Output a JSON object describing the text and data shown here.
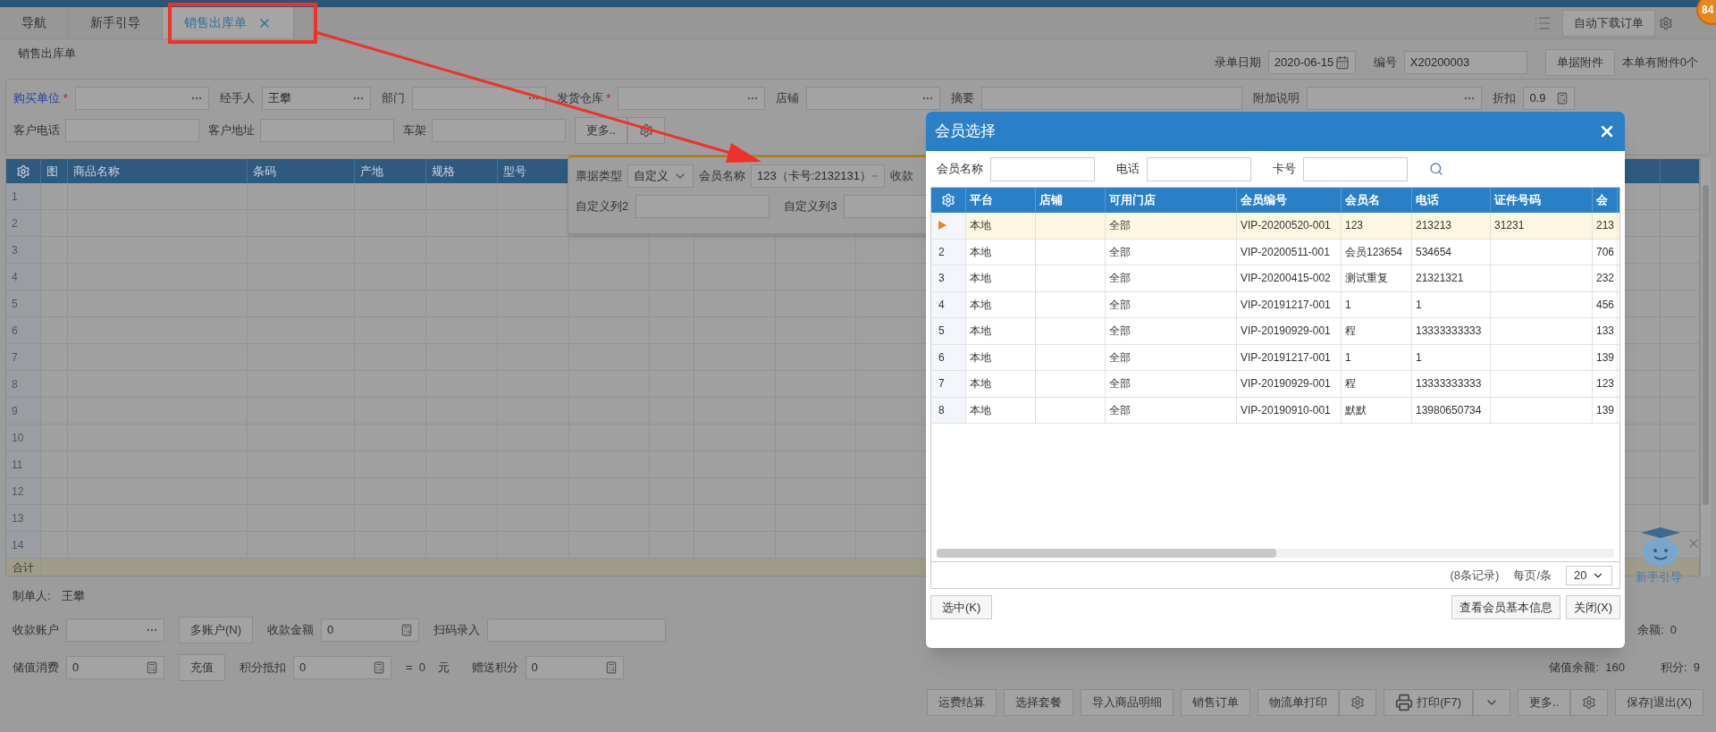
{
  "tabs": [
    {
      "label": "导航",
      "selected": false,
      "closable": false
    },
    {
      "label": "新手引导",
      "selected": false,
      "closable": false
    },
    {
      "label": "销售出库单",
      "selected": true,
      "closable": true
    }
  ],
  "top_right": {
    "button": "自动下载订单",
    "badge": "84"
  },
  "page_title": "销售出库单",
  "header_fields": [
    {
      "label": "录单日期",
      "value": "2020-06-15",
      "kind": "date"
    },
    {
      "label": "编号",
      "value": "X20200003"
    }
  ],
  "attachment": {
    "button": "单据附件",
    "note": "本单有附件0个"
  },
  "form_row_1": [
    {
      "label": "购买单位",
      "mark": "*",
      "link": true,
      "kind": "lookup"
    },
    {
      "label": "经手人",
      "value": "王攀",
      "kind": "lookup"
    },
    {
      "label": "部门",
      "kind": "lookup"
    },
    {
      "label": "发货仓库",
      "mark": "*",
      "kind": "lookup"
    },
    {
      "label": "店铺",
      "kind": "lookup"
    },
    {
      "label": "摘要"
    },
    {
      "label": "附加说明",
      "kind": "lookup"
    },
    {
      "label": "折扣",
      "value": "0.9",
      "kind": "calc"
    }
  ],
  "form_row_2": [
    {
      "label": "客户电话"
    },
    {
      "label": "客户地址"
    },
    {
      "label": "车架"
    }
  ],
  "more_button": "更多..",
  "more_panel": {
    "row_1": [
      {
        "label": "票据类型",
        "value": "自定义",
        "kind": "select"
      },
      {
        "label": "会员名称",
        "value": "123（卡号:2132131）",
        "kind": "lookup"
      },
      {
        "label": "收款",
        "kind": "cut"
      }
    ],
    "row_2": [
      {
        "label": "自定义列2"
      },
      {
        "label": "自定义列3"
      }
    ]
  },
  "grid": {
    "columns": [
      "图",
      "商品名称",
      "条码",
      "产地",
      "规格",
      "型号"
    ],
    "rows": [
      "1",
      "2",
      "3",
      "4",
      "5",
      "6",
      "7",
      "8",
      "9",
      "10",
      "11",
      "12",
      "13",
      "14"
    ],
    "total_label": "合计"
  },
  "footer": {
    "maker_label": "制单人:",
    "maker": "王攀",
    "row_1": [
      {
        "label": "收款账户",
        "kind": "lookup"
      },
      {
        "button": "多账户(N)",
        "kind": "button"
      },
      {
        "label": "收款金额",
        "value": "0",
        "kind": "calc"
      },
      {
        "label": "扫码录入",
        "kind": "wide"
      }
    ],
    "row_1_right": "余额:  0",
    "row_2": [
      {
        "label": "储值消费",
        "value": "0",
        "kind": "calc"
      },
      {
        "button": "充值",
        "kind": "button"
      },
      {
        "label": "积分抵扣",
        "value": "0",
        "kind": "calc"
      },
      {
        "text": "=  0    元",
        "kind": "text"
      },
      {
        "label": "赠送积分",
        "value": "0",
        "kind": "calc"
      }
    ],
    "row_2_right": [
      {
        "label": "储值余额:",
        "value": "160"
      },
      {
        "label": "积分:",
        "value": "9"
      }
    ]
  },
  "actions": [
    {
      "label": "运费结算",
      "kind": "plain"
    },
    {
      "label": "选择套餐",
      "kind": "plain"
    },
    {
      "label": "导入商品明细",
      "kind": "plain"
    },
    {
      "label": "销售订单",
      "kind": "plain"
    },
    {
      "label": "物流单打印",
      "kind": "gear"
    },
    {
      "label": "打印(F7)",
      "kind": "print"
    },
    {
      "label": "更多..",
      "kind": "gear"
    },
    {
      "label": "保存|退出(X)",
      "kind": "plain"
    }
  ],
  "guide": {
    "label": "新手引导"
  },
  "modal": {
    "title": "会员选择",
    "search": [
      {
        "label": "会员名称"
      },
      {
        "label": "电话"
      },
      {
        "label": "卡号"
      }
    ],
    "columns": [
      "平台",
      "店铺",
      "可用门店",
      "会员编号",
      "会员名",
      "电话",
      "证件号码",
      "会"
    ],
    "rows": [
      {
        "selected": true,
        "cells": [
          "本地",
          "",
          "全部",
          "VIP-20200520-001",
          "123",
          "213213",
          "31231",
          "213"
        ]
      },
      {
        "number": "2",
        "selected": false,
        "cells": [
          "本地",
          "",
          "全部",
          "VIP-20200511-001",
          "会员123654",
          "534654",
          "",
          "706"
        ]
      },
      {
        "number": "3",
        "selected": false,
        "cells": [
          "本地",
          "",
          "全部",
          "VIP-20200415-002",
          "测试重复",
          "21321321",
          "",
          "232"
        ]
      },
      {
        "number": "4",
        "selected": false,
        "cells": [
          "本地",
          "",
          "全部",
          "VIP-20191217-001",
          "1",
          "1",
          "",
          "456"
        ]
      },
      {
        "number": "5",
        "selected": false,
        "cells": [
          "本地",
          "",
          "全部",
          "VIP-20190929-001",
          "程",
          "13333333333",
          "",
          "133"
        ]
      },
      {
        "number": "6",
        "selected": false,
        "cells": [
          "本地",
          "",
          "全部",
          "VIP-20191217-001",
          "1",
          "1",
          "",
          "139"
        ]
      },
      {
        "number": "7",
        "selected": false,
        "cells": [
          "本地",
          "",
          "全部",
          "VIP-20190929-001",
          "程",
          "13333333333",
          "",
          "123"
        ]
      },
      {
        "number": "8",
        "selected": false,
        "cells": [
          "本地",
          "",
          "全部",
          "VIP-20190910-001",
          "默默",
          "13980650734",
          "",
          "139"
        ]
      }
    ],
    "record_count": "(8条记录)",
    "page_size_label": "每页/条",
    "page_size": "20",
    "select_button": "选中(K)",
    "info_button": "查看会员基本信息",
    "close_button": "关闭(X)"
  }
}
